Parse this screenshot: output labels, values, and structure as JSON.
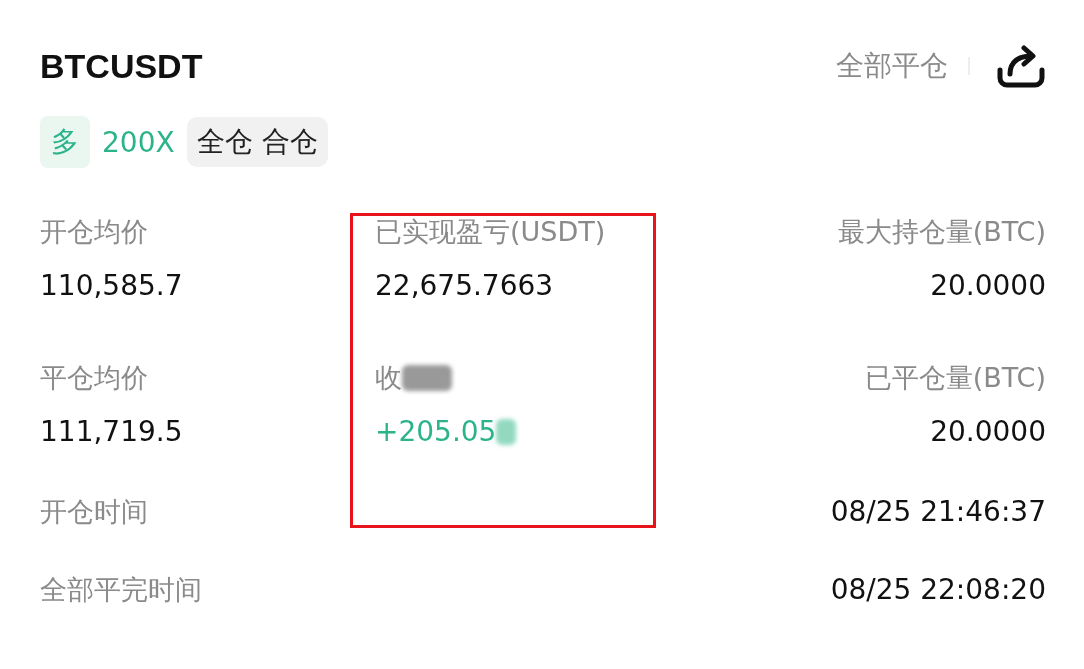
{
  "header": {
    "symbol": "BTCUSDT",
    "close_all": "全部平仓"
  },
  "tags": [
    {
      "kind": "side",
      "text": "多"
    },
    {
      "kind": "leverage",
      "text": "200X"
    },
    {
      "kind": "mode",
      "text": "全仓 合仓"
    }
  ],
  "stats": [
    {
      "label": "开仓均价",
      "value": "110,585.7",
      "kind": "plain",
      "smudged": false
    },
    {
      "label": "已实现盈亏(USDT)",
      "value": "22,675.7663",
      "kind": "plain",
      "smudged": false
    },
    {
      "label": "最大持仓量(BTC)",
      "value": "20.0000",
      "kind": "plain",
      "smudged": false
    },
    {
      "label": "平仓均价",
      "value": "111,719.5",
      "kind": "plain",
      "smudged": false
    },
    {
      "label": "收",
      "value": "+205.05",
      "kind": "gain",
      "smudged": true
    },
    {
      "label": "已平仓量(BTC)",
      "value": "20.0000",
      "kind": "plain",
      "smudged": false
    }
  ],
  "times": [
    {
      "label": "开仓时间",
      "value": "08/25 21:46:37"
    },
    {
      "label": "全部平完时间",
      "value": "08/25 22:08:20"
    }
  ],
  "highlight": {
    "kind": "red-frame"
  }
}
